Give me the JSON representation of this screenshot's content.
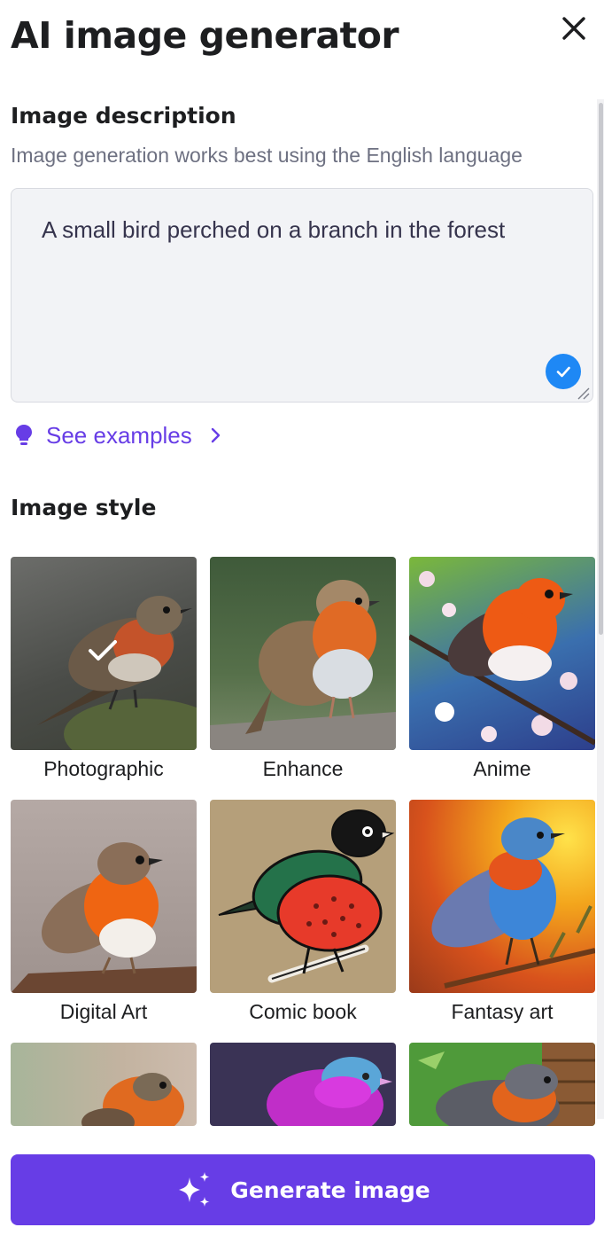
{
  "header": {
    "title": "AI image generator",
    "close_icon": "close-icon"
  },
  "description": {
    "heading": "Image description",
    "hint": "Image generation works best using the English language",
    "value": "A small bird perched on a branch in the forest",
    "valid_icon": "check-circle-icon",
    "examples_label": "See examples"
  },
  "style": {
    "heading": "Image style",
    "selected": "Photographic",
    "options": [
      {
        "label": "Photographic"
      },
      {
        "label": "Enhance"
      },
      {
        "label": "Anime"
      },
      {
        "label": "Digital Art"
      },
      {
        "label": "Comic book"
      },
      {
        "label": "Fantasy art"
      },
      {
        "label": ""
      },
      {
        "label": ""
      },
      {
        "label": ""
      }
    ]
  },
  "footer": {
    "generate_label": "Generate image",
    "generate_icon": "sparkles-icon"
  },
  "colors": {
    "accent": "#673de6",
    "valid_badge": "#1e88f5",
    "text": "#1d1e20",
    "muted": "#6d7081"
  }
}
